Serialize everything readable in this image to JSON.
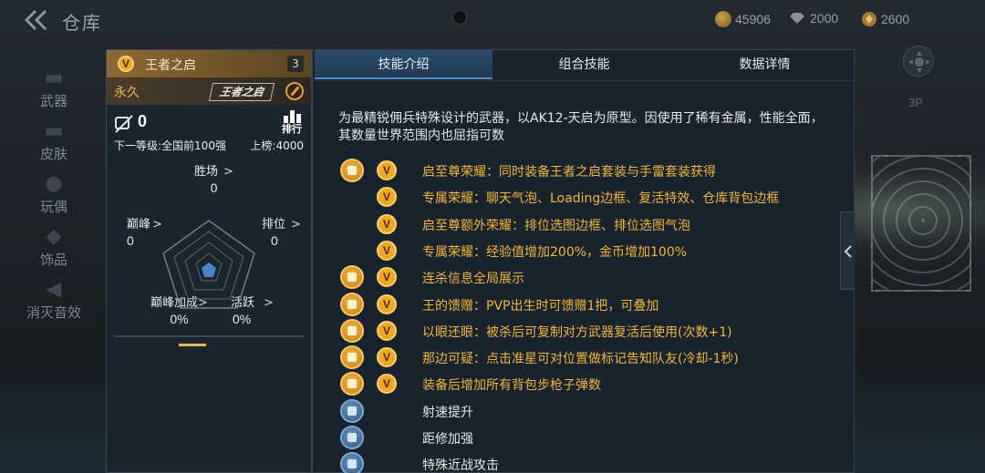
{
  "header": {
    "title": "仓库",
    "currencies": [
      {
        "icon": "gold-coin-icon",
        "value": "45906"
      },
      {
        "icon": "diamond-icon",
        "value": "2000"
      },
      {
        "icon": "gem-icon",
        "value": "2600"
      }
    ]
  },
  "nav": {
    "items": [
      {
        "label": "武器",
        "icon": "rifle-icon"
      },
      {
        "label": "皮肤",
        "icon": "skin-icon"
      },
      {
        "label": "玩偶",
        "icon": "doll-icon"
      },
      {
        "label": "饰品",
        "icon": "ornament-icon"
      },
      {
        "label": "消灭音效",
        "icon": "sound-icon"
      }
    ]
  },
  "card": {
    "badge": "V",
    "name": "王者之启",
    "count": "3",
    "duration": "永久",
    "logo_text": "王者之启",
    "kill_count": "0",
    "rank_label": "排行",
    "next_rank": "下一等级:全国前100强",
    "leaderboard": "上榜:4000",
    "stats": {
      "win": {
        "label": "胜场",
        "value": "0"
      },
      "peak": {
        "label": "巅峰",
        "value": "0"
      },
      "rank": {
        "label": "排位",
        "value": "0"
      },
      "peak_bonus": {
        "label": "巅峰加成",
        "value": "0%"
      },
      "active": {
        "label": "活跃",
        "value": "0%"
      }
    }
  },
  "panel": {
    "tabs": [
      "技能介绍",
      "组合技能",
      "数据详情"
    ],
    "active_tab": 0,
    "description": "为最精锐佣兵特殊设计的武器，以AK12-天启为原型。因使用了稀有金属，性能全面，其数量世界范围内也屈指可数",
    "skills": [
      {
        "text": "启至尊荣耀：同时装备王者之启套装与手雷套装获得",
        "icon": "crown-diamond-icon",
        "style": "gold",
        "has_v": true
      },
      {
        "text": "专属荣耀：聊天气泡、Loading边框、复活特效、仓库背包边框",
        "icon": "",
        "style": "gold",
        "has_v": true
      },
      {
        "text": "启至尊额外荣耀：排位选图边框、排位选图气泡",
        "icon": "",
        "style": "gold",
        "has_v": true
      },
      {
        "text": "专属荣耀：经验值增加200%，金币增加100%",
        "icon": "",
        "style": "gold",
        "has_v": true
      },
      {
        "text": "连杀信息全局展示",
        "icon": "killstreak-icon",
        "style": "gold",
        "has_v": true
      },
      {
        "text": "王的馈赠：PVP出生时可馈赠1把，可叠加",
        "icon": "gift-icon",
        "style": "gold",
        "has_v": true
      },
      {
        "text": "以眼还眼：被杀后可复制对方武器复活后使用(次数+1)",
        "icon": "team-icon",
        "style": "gold",
        "has_v": true
      },
      {
        "text": "那边可疑：点击准星可对位置做标记告知队友(冷却-1秒)",
        "icon": "running-man-icon",
        "style": "gold",
        "has_v": true
      },
      {
        "text": "装备后增加所有背包步枪子弹数",
        "icon": "ammo-icon",
        "style": "gold",
        "has_v": true
      },
      {
        "text": "射速提升",
        "icon": "fire-rate-icon",
        "style": "white",
        "has_v": false
      },
      {
        "text": "距修加强",
        "icon": "range-icon",
        "style": "white",
        "has_v": false
      },
      {
        "text": "特殊近战攻击",
        "icon": "melee-icon",
        "style": "white",
        "has_v": false
      }
    ]
  },
  "overlay": {
    "view_label": "3P"
  },
  "colors": {
    "accent_gold": "#f2b53c",
    "tab_active": "#2b4b6a",
    "panel_bg": "#19232d"
  }
}
